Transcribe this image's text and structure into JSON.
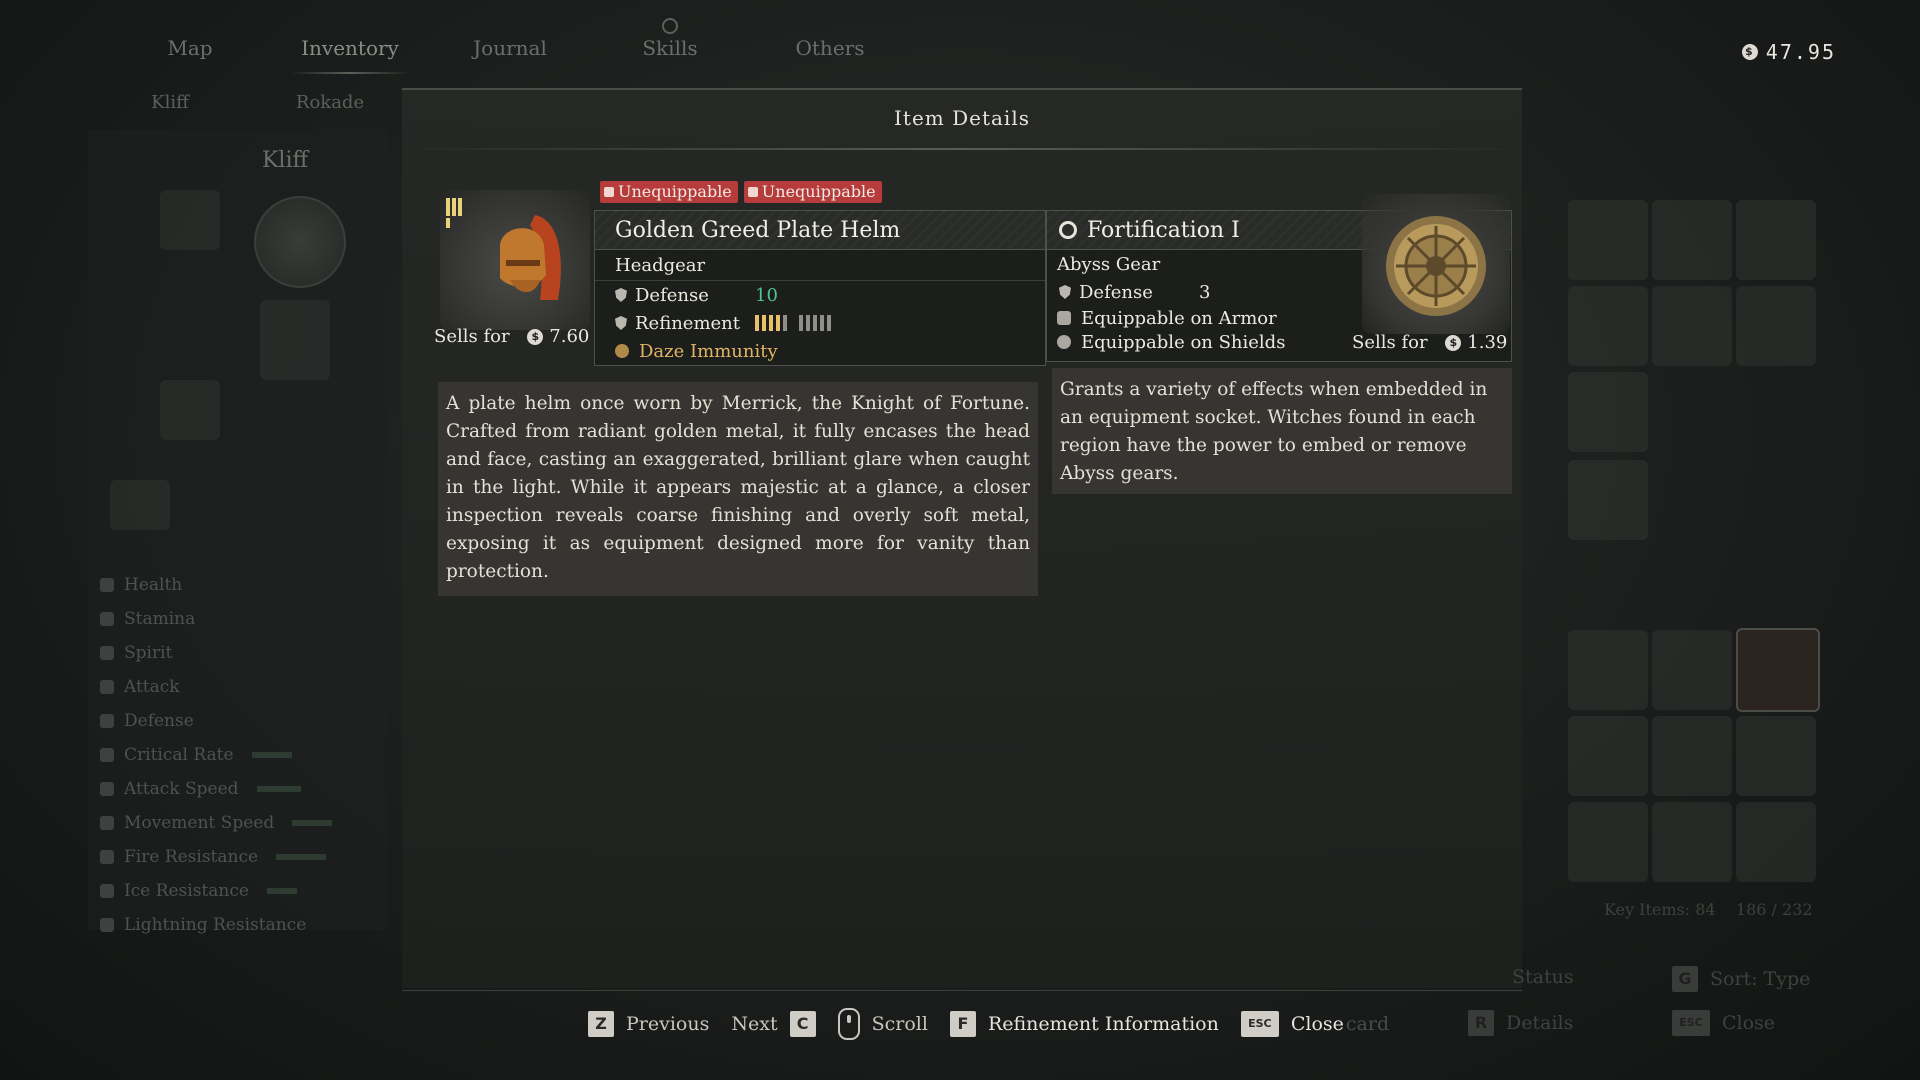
{
  "nav": {
    "tabs": [
      "Map",
      "Inventory",
      "Journal",
      "Skills",
      "Others"
    ],
    "subtabs": [
      "Kliff",
      "Rokade"
    ]
  },
  "currency": {
    "icon": "coin-icon",
    "amount": "47.95"
  },
  "character": {
    "name": "Kliff"
  },
  "stats": [
    "Health",
    "Stamina",
    "Spirit",
    "Attack",
    "Defense",
    "Critical Rate",
    "Attack Speed",
    "Movement Speed",
    "Fire Resistance",
    "Ice Resistance",
    "Lightning Resistance"
  ],
  "inventory": {
    "key_items": "Key Items: 84",
    "capacity": "186 / 232",
    "sort": "Sort: Type",
    "status": "Status",
    "details": "Details",
    "close": "Close"
  },
  "dialog": {
    "title": "Item Details",
    "item": {
      "tags": [
        "Unequippable",
        "Unequippable"
      ],
      "name": "Golden Greed Plate Helm",
      "category": "Headgear",
      "defense_label": "Defense",
      "defense_value": "10",
      "refinement_label": "Refinement",
      "refinement_level": 4,
      "refinement_max": 10,
      "ability": "Daze Immunity",
      "sells_label": "Sells for",
      "sells_value": "7.60",
      "description": "A plate helm once worn by Merrick, the Knight of Fortune. Crafted from radiant golden metal, it fully encases the head and face, casting an exaggerated, brilliant glare when caught in the light. While it appears majestic at a glance, a closer inspection reveals coarse finishing and overly soft metal, exposing it as equipment designed more for vanity than protection."
    },
    "gear": {
      "name": "Fortification I",
      "category": "Abyss Gear",
      "defense_label": "Defense",
      "defense_value": "3",
      "equip_armor": "Equippable on Armor",
      "equip_shields": "Equippable on Shields",
      "sells_label": "Sells for",
      "sells_value": "1.39",
      "description": "Grants a variety of effects when embedded in an equipment socket. Witches found in each region have the power to embed or remove Abyss gears."
    }
  },
  "hints": {
    "previous_key": "Z",
    "previous": "Previous",
    "next": "Next",
    "next_key": "C",
    "scroll": "Scroll",
    "refine_key": "F",
    "refine": "Refinement Information",
    "close_key": "ESC",
    "close": "Close",
    "discard_ghost": "card"
  },
  "colors": {
    "accent_green": "#4fc29a",
    "tag_red": "#b53c3a",
    "refine_gold": "#e7c26a",
    "ability_gold": "#e2b565"
  }
}
